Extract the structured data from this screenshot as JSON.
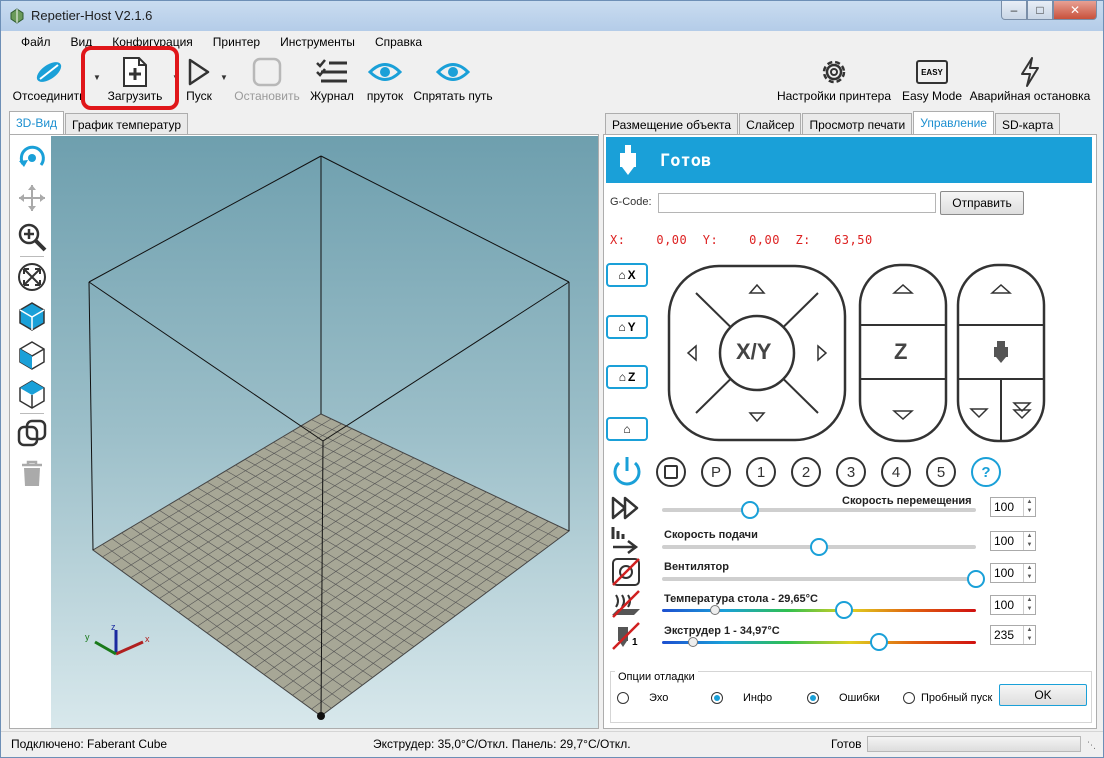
{
  "window": {
    "title": "Repetier-Host V2.1.6"
  },
  "menu": [
    "Файл",
    "Вид",
    "Конфигурация",
    "Принтер",
    "Инструменты",
    "Справка"
  ],
  "toolbar": {
    "disconnect": "Отсоединить",
    "load": "Загрузить",
    "run": "Пуск",
    "stop": "Остановить",
    "log": "Журнал",
    "filament": "пруток",
    "hide_path": "Спрятать путь",
    "printer_settings": "Настройки принтера",
    "easy_mode": "Easy Mode",
    "easy_badge": "EASY",
    "emergency_stop": "Аварийная остановка"
  },
  "left_tabs": [
    "3D-Вид",
    "График температур"
  ],
  "right_tabs": [
    "Размещение объекта",
    "Слайсер",
    "Просмотр печати",
    "Управление",
    "SD-карта"
  ],
  "control": {
    "status": "Готов",
    "gcode_label": "G-Code:",
    "send_button": "Отправить",
    "coords_x_label": "X:",
    "coords_x": "0,00",
    "coords_y_label": "Y:",
    "coords_y": "0,00",
    "coords_z_label": "Z:",
    "coords_z": "63,50",
    "home_x": "X",
    "home_y": "Y",
    "home_z": "Z",
    "jog_xy": "X/Y",
    "jog_z": "Z",
    "round_buttons": [
      "P",
      "1",
      "2",
      "3",
      "4",
      "5",
      "?"
    ],
    "sliders": [
      {
        "label": "Скорость перемещения",
        "value": "100",
        "level": 0.28
      },
      {
        "label": "Скорость подачи",
        "value": "100",
        "level": 0.5
      },
      {
        "label": "Вентилятор",
        "value": "100",
        "level": 1.0
      },
      {
        "label": "Температура стола - 29,65°C",
        "value": "100",
        "level": 0.58,
        "current": 0.17
      },
      {
        "label": "Экструдер 1 - 34,97°C",
        "value": "235",
        "level": 0.69,
        "current": 0.1
      }
    ],
    "extruder_index": "1",
    "debug": {
      "title": "Опции отладки",
      "echo": "Эхо",
      "info": "Инфо",
      "errors": "Ошибки",
      "dry_run": "Пробный пуск",
      "ok": "OK"
    }
  },
  "status": {
    "connected": "Подключено: Faberant Cube",
    "temps": "Экструдер: 35,0°C/Откл. Панель: 29,7°C/Откл.",
    "state": "Готов"
  },
  "colors": {
    "accent": "#1aa0d8",
    "highlight": "#e0161a",
    "coords": "#d22222"
  }
}
